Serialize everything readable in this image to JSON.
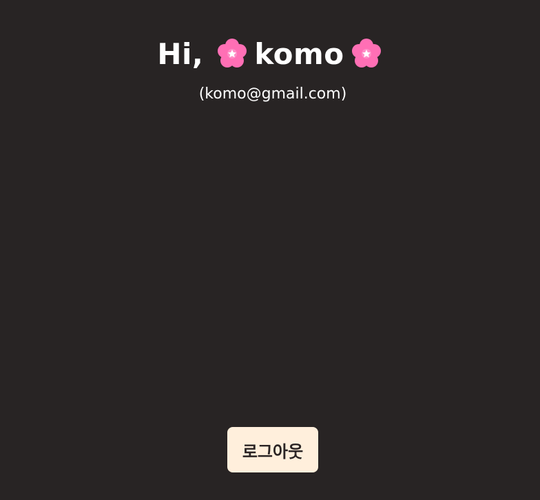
{
  "profile": {
    "greeting": "Hi,",
    "username": "komo",
    "email": "(komo@gmail.com)"
  },
  "icons": {
    "left_flower": "cherry-blossom-icon",
    "right_flower": "cherry-blossom-icon"
  },
  "actions": {
    "logout_label": "로그아웃"
  },
  "colors": {
    "background": "#282424",
    "text": "#ffffff",
    "button_bg": "#ffefdc",
    "button_text": "#2a2424",
    "flower": "#ff6fb5"
  }
}
